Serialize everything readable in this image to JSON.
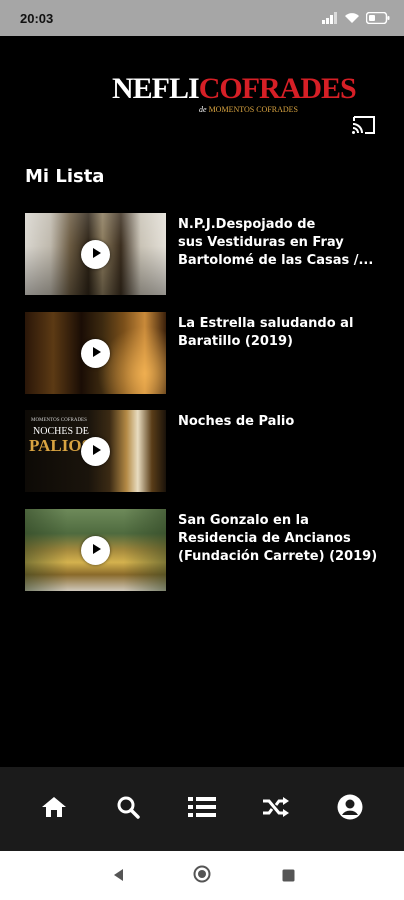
{
  "status_bar": {
    "time": "20:03",
    "icons": [
      "signal-icon",
      "wifi-icon",
      "battery-icon"
    ]
  },
  "header": {
    "logo_part1": "NEFLI",
    "logo_part2": "COFRADES",
    "logo_sub_prefix": "de",
    "logo_sub_brand": "MOMENTOS COFRADES",
    "cast_icon": "cast-icon"
  },
  "section": {
    "title": "Mi Lista"
  },
  "items": [
    {
      "title": "N.P.J.Despojado de\nsus Vestiduras en  Fray\nBartolomé de las Casas /..."
    },
    {
      "title": "La Estrella saludando al\nBaratillo (2019)"
    },
    {
      "title": "Noches de Palio",
      "thumb_text_top": "MOMENTOS COFRADES",
      "thumb_text_main1": "NOCHES DE",
      "thumb_text_main2": "PALIOS"
    },
    {
      "title": "San Gonzalo en la\nResidencia de Ancianos\n(Fundación Carrete) (2019)"
    }
  ],
  "bottom_nav": {
    "items": [
      "home-icon",
      "search-icon",
      "list-icon",
      "shuffle-icon",
      "profile-icon"
    ]
  },
  "system_nav": {
    "items": [
      "back-icon",
      "home-circle-icon",
      "recents-icon"
    ]
  },
  "colors": {
    "brand_red": "#d61f26",
    "brand_gold": "#d9a441",
    "background": "#000000",
    "nav_bg": "#1b1b1b"
  }
}
